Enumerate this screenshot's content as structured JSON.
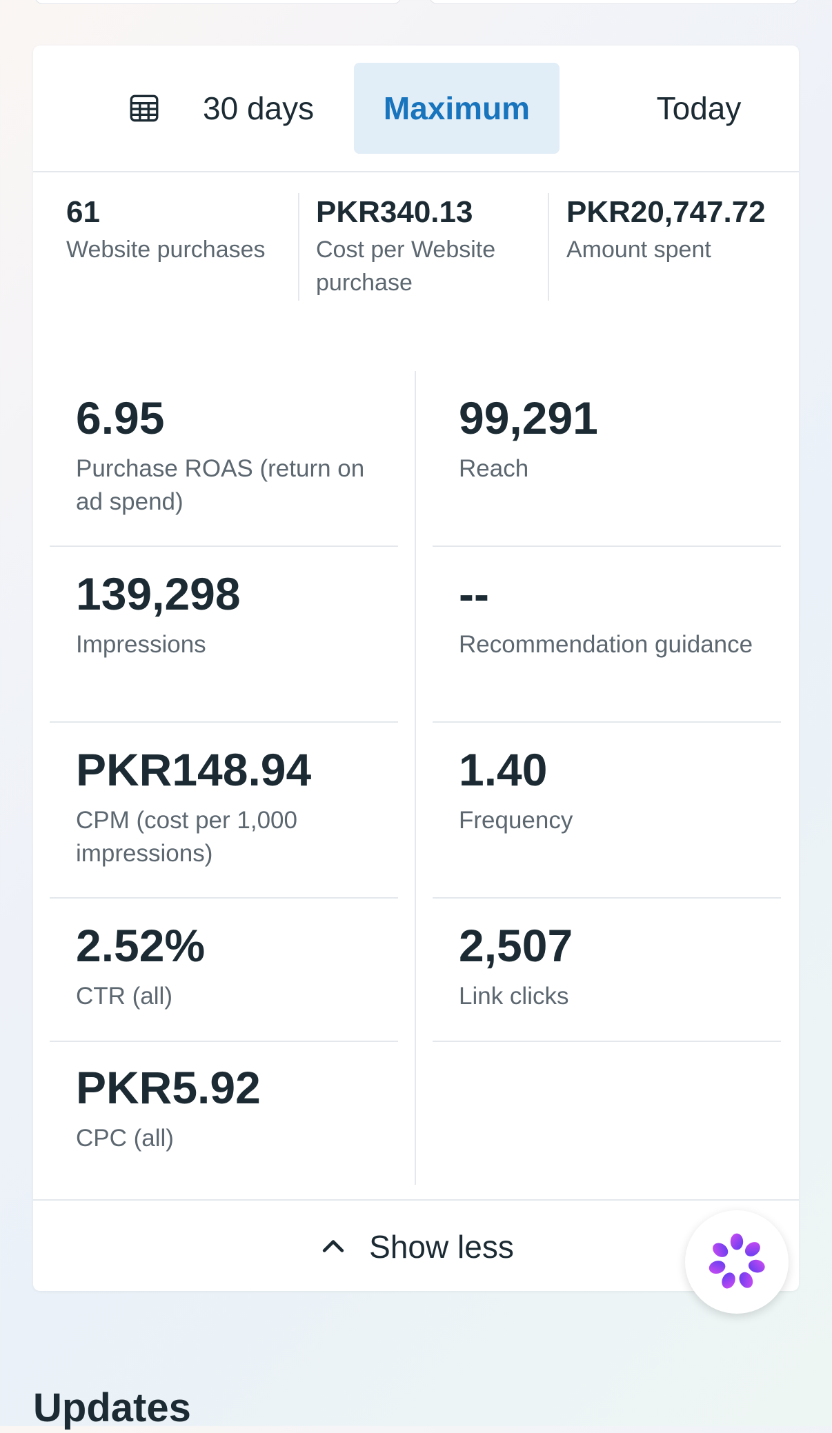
{
  "date_range": {
    "tabs": [
      {
        "label": "30 days",
        "icon": "calendar-icon"
      },
      {
        "label": "Maximum",
        "selected": true
      },
      {
        "label": "Today"
      }
    ]
  },
  "summary": [
    {
      "value": "61",
      "label": "Website purchases"
    },
    {
      "value": "PKR340.13",
      "label": "Cost per Website purchase"
    },
    {
      "value": "PKR20,747.72",
      "label": "Amount spent"
    }
  ],
  "metrics": [
    {
      "value": "6.95",
      "label": "Purchase ROAS (return on ad spend)"
    },
    {
      "value": "99,291",
      "label": "Reach"
    },
    {
      "value": "139,298",
      "label": "Impressions"
    },
    {
      "value": "--",
      "label": "Recommendation guidance"
    },
    {
      "value": "PKR148.94",
      "label": "CPM (cost per 1,000 impressions)"
    },
    {
      "value": "1.40",
      "label": "Frequency"
    },
    {
      "value": "2.52%",
      "label": "CTR (all)"
    },
    {
      "value": "2,507",
      "label": "Link clicks"
    },
    {
      "value": "PKR5.92",
      "label": "CPC (all)"
    }
  ],
  "show_less": {
    "label": "Show less",
    "icon": "chevron-up-icon"
  },
  "assistant": {
    "icon": "ai-assistant-icon"
  },
  "updates": {
    "heading": "Updates"
  },
  "colors": {
    "accent": "#1874bc",
    "selected_tab_bg": "#e1edf7",
    "text_primary": "#1c2b33",
    "text_secondary": "#5c6770",
    "divider": "#e4e8ec"
  }
}
